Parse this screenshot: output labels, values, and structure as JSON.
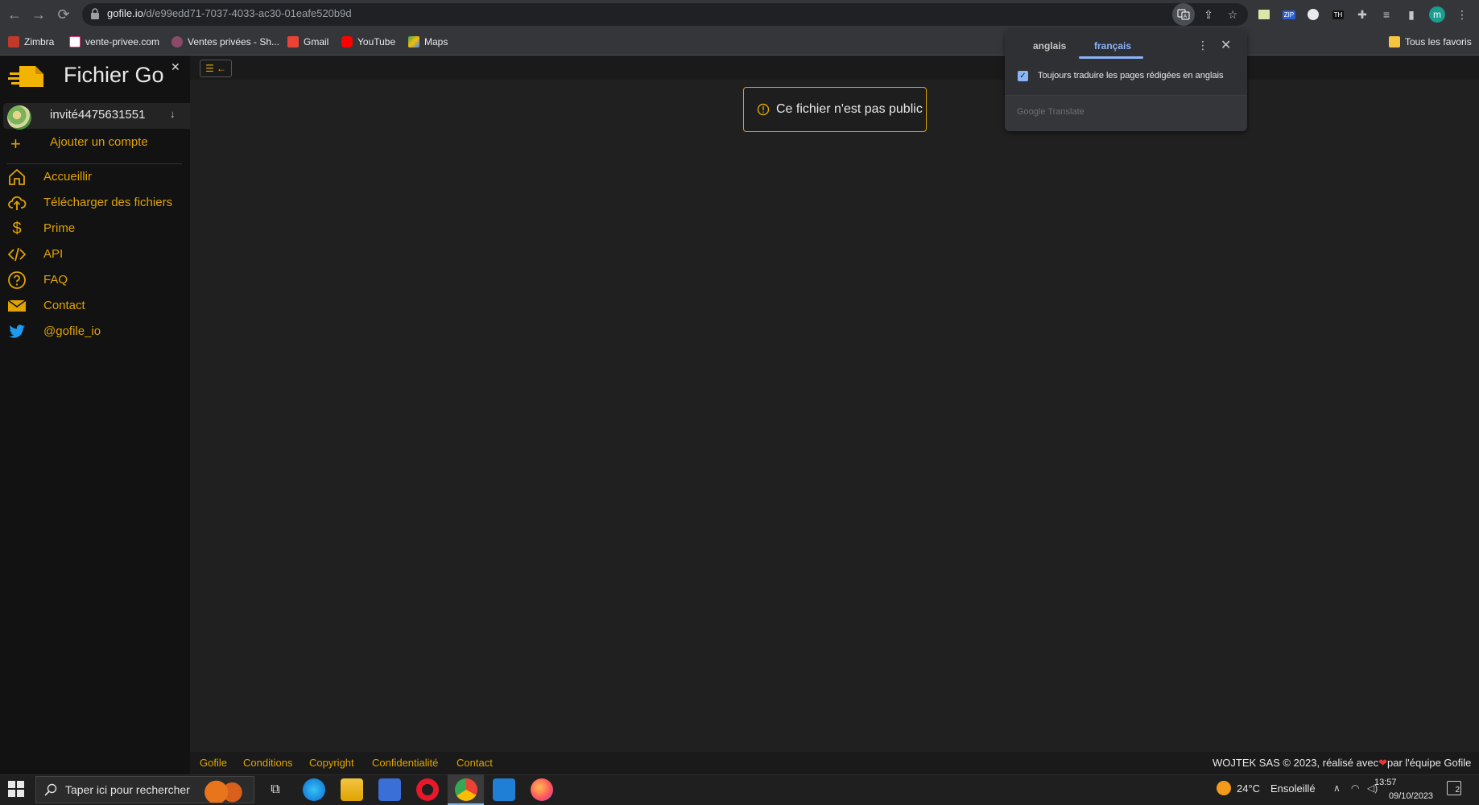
{
  "browser": {
    "url_host": "gofile.io",
    "url_path": "/d/e99edd71-7037-4033-ac30-01eafe520b9d",
    "bookmarks": [
      "Zimbra",
      "vente-privee.com",
      "Ventes privées - Sh...",
      "Gmail",
      "YouTube",
      "Maps"
    ],
    "all_bookmarks": "Tous les favoris",
    "profile_letter": "m"
  },
  "translate": {
    "tab_source": "anglais",
    "tab_target": "français",
    "always_label": "Toujours traduire les pages rédigées en anglais",
    "brand": "Google Translate"
  },
  "sidebar": {
    "app_title": "Fichier Go",
    "account_name": "invité4475631551",
    "add_account": "Ajouter un compte",
    "items": [
      {
        "label": "Accueillir",
        "icon": "home-icon"
      },
      {
        "label": "Télécharger des fichiers",
        "icon": "cloud-upload-icon"
      },
      {
        "label": "Prime",
        "icon": "dollar-icon"
      },
      {
        "label": "API",
        "icon": "code-icon"
      },
      {
        "label": "FAQ",
        "icon": "question-icon"
      },
      {
        "label": "Contact",
        "icon": "envelope-icon"
      },
      {
        "label": "@gofile_io",
        "icon": "twitter-icon"
      }
    ]
  },
  "main": {
    "alert": "Ce fichier n'est pas public"
  },
  "footer": {
    "links": [
      "Gofile",
      "Conditions",
      "Copyright",
      "Confidentialité",
      "Contact"
    ],
    "copyright_pre": "WOJTEK SAS © 2023, réalisé avec",
    "heart": "❤",
    "copyright_post": "par l'équipe Gofile"
  },
  "taskbar": {
    "search_placeholder": "Taper ici pour rechercher",
    "temperature": "24°C",
    "weather": "Ensoleillé",
    "time": "13:57",
    "date": "09/10/2023",
    "notifications": "2"
  },
  "colors": {
    "accent": "#e0a300",
    "sidebar_bg": "#121212",
    "main_bg": "#202020"
  }
}
